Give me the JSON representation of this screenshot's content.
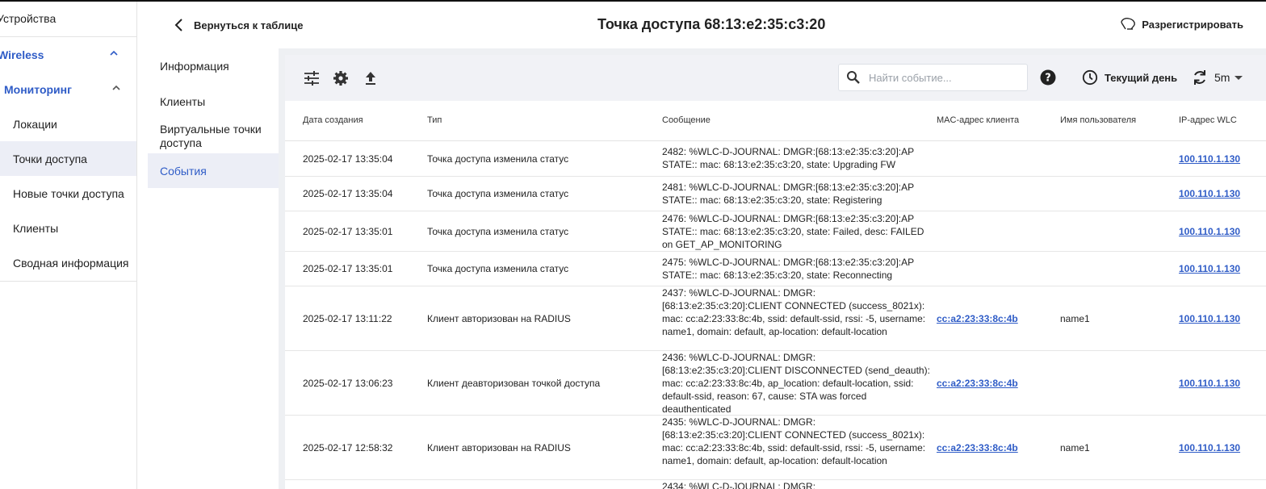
{
  "sidebar": {
    "items": [
      {
        "label": "Устройства"
      },
      {
        "label": "Wireless"
      },
      {
        "label": "Мониторинг"
      },
      {
        "label": "Локации"
      },
      {
        "label": "Точки доступа"
      },
      {
        "label": "Новые точки доступа"
      },
      {
        "label": "Клиенты"
      },
      {
        "label": "Сводная информация"
      }
    ]
  },
  "header": {
    "back_label": "Вернуться к таблице",
    "title": "Точка доступа 68:13:e2:35:c3:20",
    "unregister_label": "Разрегистрировать"
  },
  "subnav": {
    "items": [
      {
        "label": "Информация"
      },
      {
        "label": "Клиенты"
      },
      {
        "label": "Виртуальные точки доступа"
      },
      {
        "label": "События"
      }
    ]
  },
  "toolbar": {
    "search_placeholder": "Найти событие...",
    "period_label": "Текущий день",
    "refresh_interval": "5m"
  },
  "table": {
    "columns": [
      "Дата создания",
      "Тип",
      "Сообщение",
      "MAC-адрес клиента",
      "Имя пользователя",
      "IP-адрес WLC"
    ],
    "rows": [
      {
        "date": "2025-02-17 13:35:04",
        "type": "Точка доступа изменила статус",
        "message": "2482: %WLC-D-JOURNAL: DMGR:[68:13:e2:35:c3:20]:AP STATE:: mac: 68:13:e2:35:c3:20, state: Upgrading FW",
        "mac": "",
        "user": "",
        "ip": "100.110.1.130"
      },
      {
        "date": "2025-02-17 13:35:04",
        "type": "Точка доступа изменила статус",
        "message": "2481: %WLC-D-JOURNAL: DMGR:[68:13:e2:35:c3:20]:AP STATE:: mac: 68:13:e2:35:c3:20, state: Registering",
        "mac": "",
        "user": "",
        "ip": "100.110.1.130"
      },
      {
        "date": "2025-02-17 13:35:01",
        "type": "Точка доступа изменила статус",
        "message": "2476: %WLC-D-JOURNAL: DMGR:[68:13:e2:35:c3:20]:AP STATE:: mac: 68:13:e2:35:c3:20, state: Failed, desc: FAILED on GET_AP_MONITORING",
        "mac": "",
        "user": "",
        "ip": "100.110.1.130"
      },
      {
        "date": "2025-02-17 13:35:01",
        "type": "Точка доступа изменила статус",
        "message": "2475: %WLC-D-JOURNAL: DMGR:[68:13:e2:35:c3:20]:AP STATE:: mac: 68:13:e2:35:c3:20, state: Reconnecting",
        "mac": "",
        "user": "",
        "ip": "100.110.1.130"
      },
      {
        "date": "2025-02-17 13:11:22",
        "type": "Клиент авторизован на RADIUS",
        "message": "2437: %WLC-D-JOURNAL: DMGR:[68:13:e2:35:c3:20]:CLIENT CONNECTED (success_8021x): mac: cc:a2:23:33:8c:4b, ssid: default-ssid, rssi: -5, username: name1, domain: default, ap-location: default-location",
        "mac": "cc:a2:23:33:8c:4b",
        "user": "name1",
        "ip": "100.110.1.130"
      },
      {
        "date": "2025-02-17 13:06:23",
        "type": "Клиент деавторизован точкой доступа",
        "message": "2436: %WLC-D-JOURNAL: DMGR:[68:13:e2:35:c3:20]:CLIENT DISCONNECTED (send_deauth): mac: cc:a2:23:33:8c:4b, ap_location: default-location, ssid: default-ssid, reason: 67, cause: STA was forced deauthenticated",
        "mac": "cc:a2:23:33:8c:4b",
        "user": "",
        "ip": "100.110.1.130"
      },
      {
        "date": "2025-02-17 12:58:32",
        "type": "Клиент авторизован на RADIUS",
        "message": "2435: %WLC-D-JOURNAL: DMGR:[68:13:e2:35:c3:20]:CLIENT CONNECTED (success_8021x): mac: cc:a2:23:33:8c:4b, ssid: default-ssid, rssi: -5, username: name1, domain: default, ap-location: default-location",
        "mac": "cc:a2:23:33:8c:4b",
        "user": "name1",
        "ip": "100.110.1.130"
      },
      {
        "date": "",
        "type": "",
        "message": "2434: %WLC-D-JOURNAL: DMGR:",
        "mac": "",
        "user": "",
        "ip": ""
      }
    ]
  },
  "colors": {
    "accent": "#2f5cc7",
    "active_bg": "#eceef6",
    "toolbar_bg": "#f1f2f6"
  }
}
